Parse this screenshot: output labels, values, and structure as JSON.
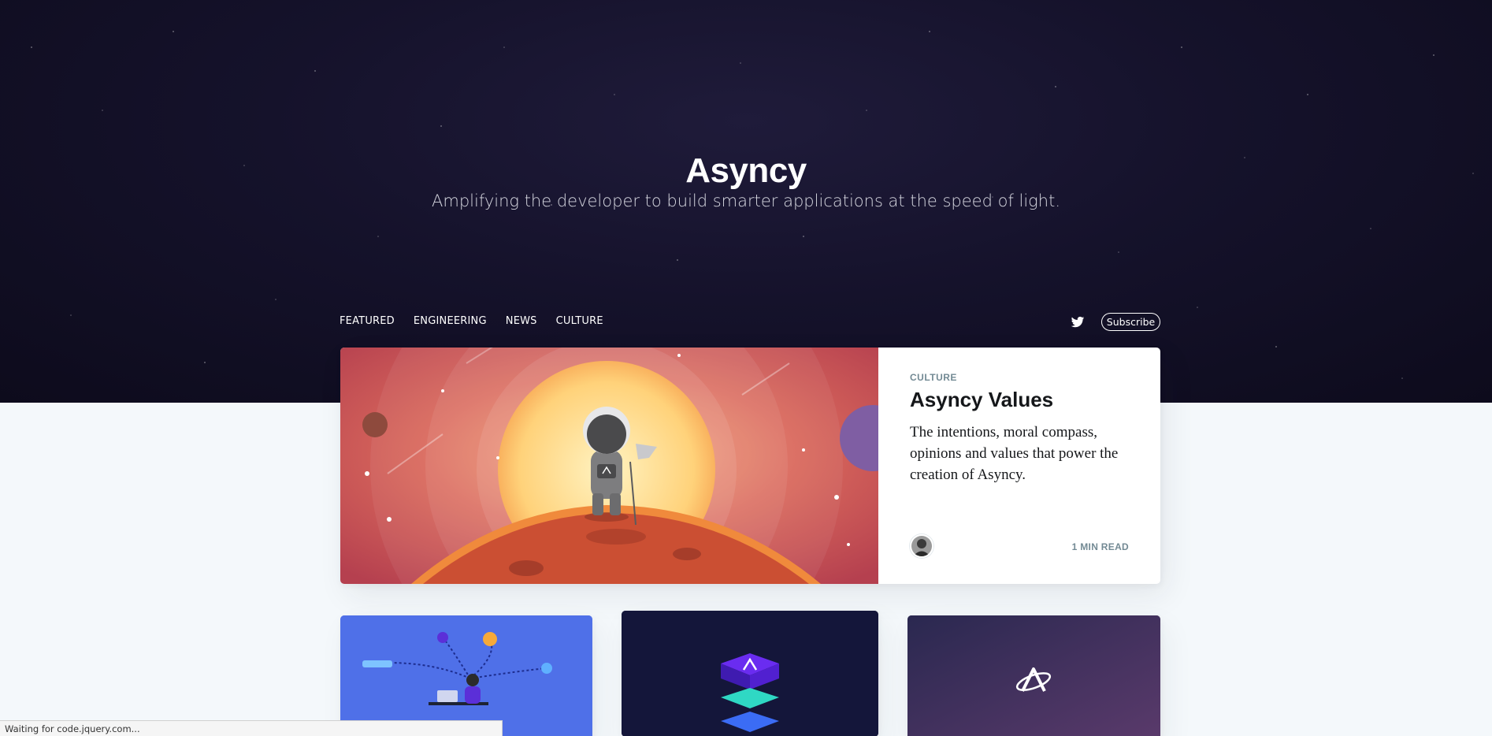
{
  "site": {
    "title": "Asyncy",
    "description": "Amplifying the developer to build smarter applications at the speed of light."
  },
  "nav": {
    "items": [
      "FEATURED",
      "ENGINEERING",
      "NEWS",
      "CULTURE"
    ],
    "subscribe_label": "Subscribe",
    "social_icon": "twitter-icon"
  },
  "featured_post": {
    "tag": "CULTURE",
    "title": "Asyncy Values",
    "excerpt": "The intentions, moral compass, opinions and values that power the creation of Asyncy.",
    "reading_time": "1 MIN READ",
    "image_icon": "astronaut-illustration"
  },
  "post_cards": [
    {
      "image_icon": "developer-desk-illustration",
      "color": "#4f70e8"
    },
    {
      "image_icon": "platform-stack-illustration",
      "color": "#14163a"
    },
    {
      "image_icon": "asyncy-logo",
      "color": "#2c2a50"
    }
  ],
  "status_bar": {
    "text": "Waiting for code.jquery.com..."
  },
  "colors": {
    "hero_bg": "#15122b",
    "body_bg": "#f4f8fb",
    "meta_text": "#738a94"
  }
}
